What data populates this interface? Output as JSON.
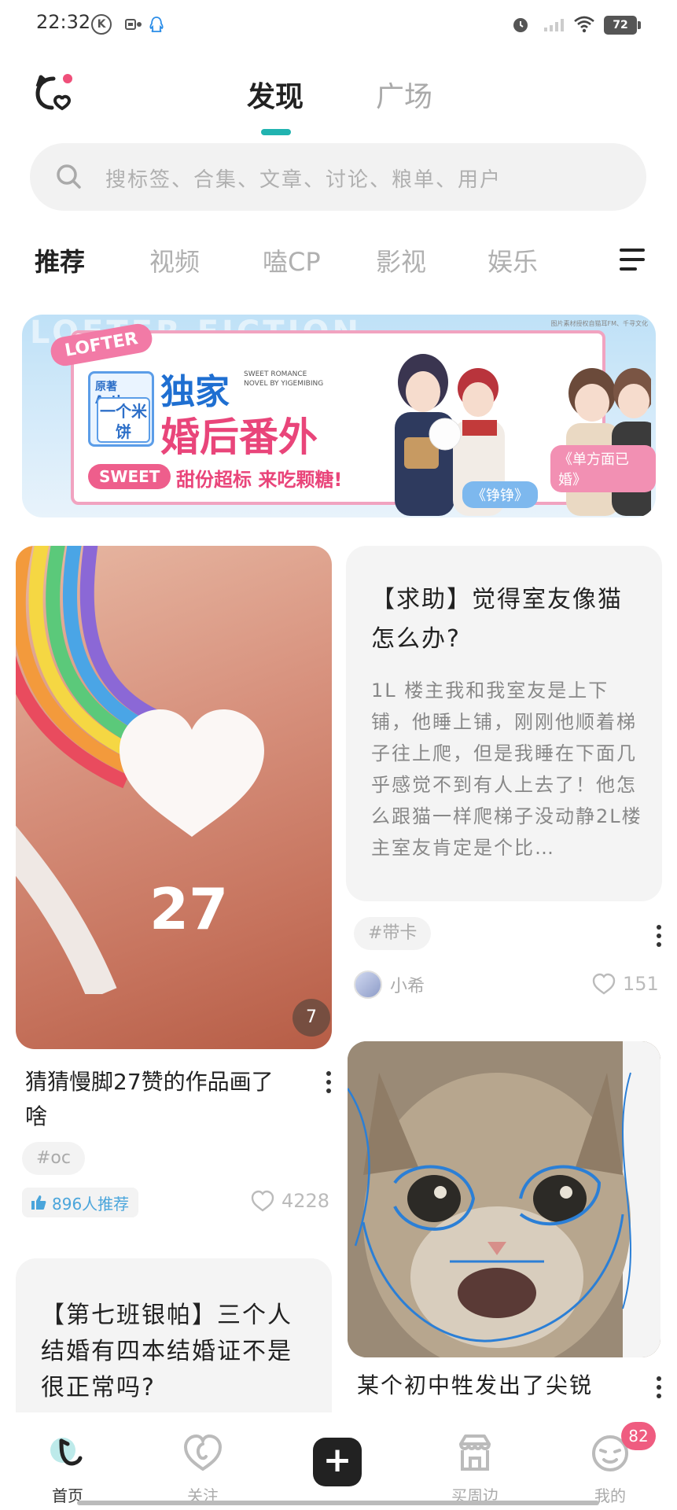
{
  "status_bar": {
    "time": "22:32",
    "k_icon": "K",
    "battery": "72",
    "icons": [
      "k-circle-icon",
      "sim-icon",
      "qq-icon",
      "alarm-icon",
      "signal-icon",
      "wifi-icon",
      "battery-icon"
    ]
  },
  "header": {
    "tabs": [
      "发现",
      "广场"
    ],
    "active_tab": "发现",
    "accent": "#21b3b0"
  },
  "search": {
    "placeholder": "搜标签、合集、文章、讨论、粮单、用户"
  },
  "categories": {
    "items": [
      "推荐",
      "视频",
      "嗑CP",
      "影视",
      "娱乐"
    ],
    "active": "推荐"
  },
  "banner": {
    "bg_text": "LOFTER FICTION",
    "brand": "LOFTER",
    "author_label": "原著 Author",
    "author_name": "一个米饼",
    "title_line1": "独家",
    "title_line2": "婚后番外",
    "subtitle": "SWEET ROMANCE NOVEL BY YIGEMIBING",
    "sweet_label": "SWEET",
    "tagline": "甜份超标 来吃颗糖!",
    "book1": "《铮铮》",
    "book2": "《单方面已婚》",
    "credit": "图片素材授权自猫耳FM、千寻文化"
  },
  "feed": {
    "left_post": {
      "image_count": "7",
      "image_text": "27",
      "title": "猜猜慢脚27赞的作品画了啥",
      "tag": "#oc",
      "recommend": "896人推荐",
      "likes": "4228"
    },
    "right_text_post": {
      "title": "【求助】觉得室友像猫怎么办?",
      "body": "1L 楼主我和我室友是上下铺，他睡上铺，刚刚他顺着梯子往上爬，但是我睡在下面几乎感觉不到有人上去了！他怎么跟猫一样爬梯子没动静2L楼主室友肯定是个比…",
      "tag": "#带卡",
      "author": "小希",
      "likes": "151"
    },
    "right_img_post": {
      "title": "某个初中牲发出了尖锐"
    },
    "left_text_post": {
      "title": "【第七班银帕】三个人结婚有四本结婚证不是很正常吗?"
    }
  },
  "bottom_nav": {
    "items": [
      "首页",
      "关注",
      "",
      "买周边",
      "我的"
    ],
    "add": "+",
    "badge": "82",
    "active": "首页"
  }
}
